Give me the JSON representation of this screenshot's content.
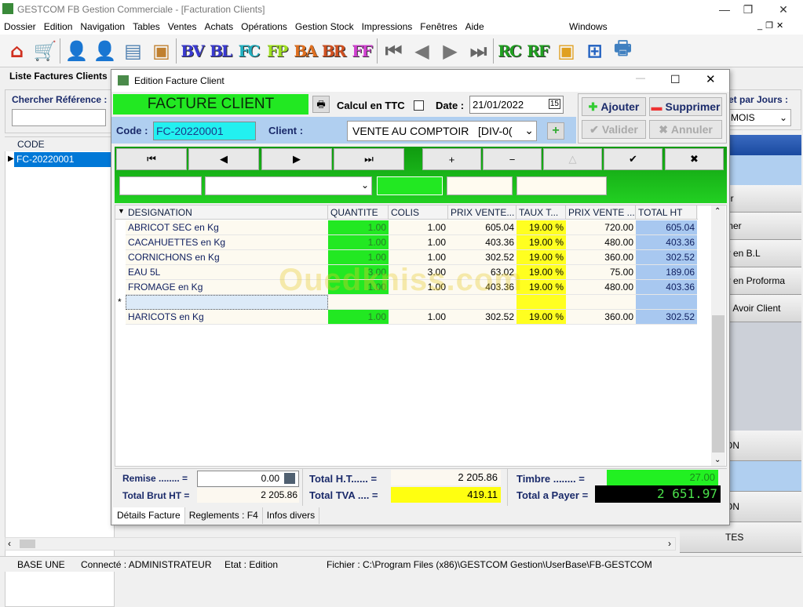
{
  "window": {
    "title": "GESTCOM FB Gestion Commerciale - [Facturation Clients]"
  },
  "menu": [
    "Dossier",
    "Edition",
    "Navigation",
    "Tables",
    "Ventes",
    "Achats",
    "Opérations",
    "Gestion Stock",
    "Impressions",
    "Fenêtres",
    "Aide"
  ],
  "menu_right": "Windows",
  "toolbar": [
    {
      "icon": "home-icon"
    },
    {
      "icon": "cart-icon"
    },
    {
      "icon": "client-icon"
    },
    {
      "icon": "supplier-icon"
    },
    {
      "icon": "cash-register-icon"
    },
    {
      "icon": "open-box-icon"
    },
    {
      "label": "BV",
      "color": "#3a3ad0"
    },
    {
      "label": "BL",
      "color": "#3a3ad0"
    },
    {
      "label": "FC",
      "color": "#20b0c0"
    },
    {
      "label": "FP",
      "color": "#a0e020"
    },
    {
      "label": "BA",
      "color": "#e07020"
    },
    {
      "label": "BR",
      "color": "#d05020"
    },
    {
      "label": "FF",
      "color": "#d040d0"
    },
    {
      "icon": "first-arrow-icon"
    },
    {
      "icon": "prev-arrow-icon"
    },
    {
      "icon": "next-arrow-icon"
    },
    {
      "icon": "last-arrow-icon"
    },
    {
      "label": "RC",
      "color": "#20a020"
    },
    {
      "label": "RF",
      "color": "#20a020"
    },
    {
      "icon": "box-icon"
    },
    {
      "icon": "network-icon"
    },
    {
      "icon": "printer-icon"
    }
  ],
  "left_panel": {
    "title": "Liste Factures Clients",
    "search_label": "Chercher Référence :",
    "search_value": "",
    "column": "CODE",
    "rows": [
      "FC-20220001"
    ]
  },
  "right_panel": {
    "filter_label": "et par Jours :",
    "filter_value": "MOIS",
    "items": [
      "er",
      "mer",
      "ir en B.L",
      "ir en Proforma",
      "n Avoir Client"
    ],
    "bottom_items": [
      "ON",
      "",
      "ON",
      "TES"
    ]
  },
  "dialog": {
    "title": "Edition Facture Client",
    "banner": "FACTURE CLIENT",
    "calc_ttc_label": "Calcul en TTC",
    "calc_ttc_checked": false,
    "date_label": "Date :",
    "date_value": "21/01/2022",
    "code_label": "Code :",
    "code_value": "FC-20220001",
    "client_label": "Client :",
    "client_value": "VENTE AU COMPTOIR   [DIV-0(",
    "buttons": {
      "add": "Ajouter",
      "delete": "Supprimer",
      "validate": "Valider",
      "cancel": "Annuler"
    },
    "nav": [
      "⏮",
      "◀",
      "▶",
      "⏭",
      "+",
      "−",
      "△",
      "✔",
      "✖"
    ],
    "columns": [
      "DESIGNATION",
      "QUANTITE",
      "COLIS",
      "PRIX VENTE...",
      "TAUX T...",
      "PRIX VENTE ...",
      "TOTAL HT"
    ],
    "rows": [
      [
        "ABRICOT SEC en Kg",
        "1.00",
        "1.00",
        "605.04",
        "19.00 %",
        "720.00",
        "605.04"
      ],
      [
        "CACAHUETTES en Kg",
        "1.00",
        "1.00",
        "403.36",
        "19.00 %",
        "480.00",
        "403.36"
      ],
      [
        "CORNICHONS en Kg",
        "1.00",
        "1.00",
        "302.52",
        "19.00 %",
        "360.00",
        "302.52"
      ],
      [
        "EAU 5L",
        "3.00",
        "3.00",
        "63.02",
        "19.00 %",
        "75.00",
        "189.06"
      ],
      [
        "FROMAGE en Kg",
        "1.00",
        "1.00",
        "403.36",
        "19.00 %",
        "480.00",
        "403.36"
      ],
      [
        "",
        "",
        "",
        "",
        "",
        "",
        ""
      ],
      [
        "HARICOTS en Kg",
        "1.00",
        "1.00",
        "302.52",
        "19.00 %",
        "360.00",
        "302.52"
      ]
    ],
    "new_row_marker": "*",
    "totals": {
      "remise_label": "Remise ........ =",
      "remise": "0.00",
      "brut_label": "Total Brut HT =",
      "brut": "2 205.86",
      "ht_label": "Total H.T...... =",
      "ht": "2 205.86",
      "tva_label": "Total TVA .... =",
      "tva": "419.11",
      "timbre_label": "Timbre  ........ =",
      "timbre": "27.00",
      "payer_label": "Total a Payer =",
      "payer": "2 651.97"
    },
    "tabs": [
      "Détails Facture",
      "Reglements : F4",
      "Infos divers"
    ],
    "watermark": "Ouedkniss.com"
  },
  "status": {
    "base": "BASE UNE",
    "user": "Connecté : ADMINISTRATEUR",
    "etat": "Etat : Edition",
    "file": "Fichier : C:\\Program Files (x86)\\GESTCOM Gestion\\UserBase\\FB-GESTCOM"
  }
}
